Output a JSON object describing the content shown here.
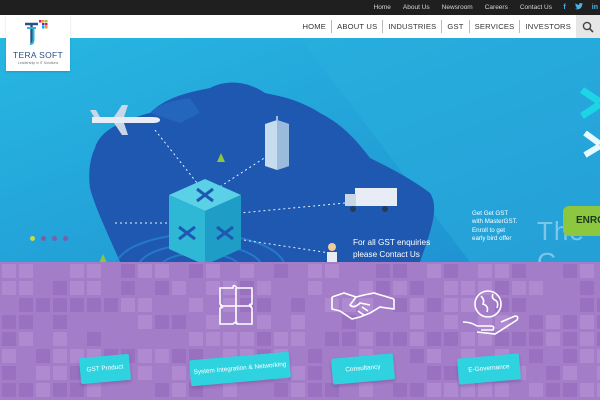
{
  "top_links": [
    "Home",
    "About Us",
    "Newsroom",
    "Careers",
    "Contact Us"
  ],
  "social": [
    {
      "icon": "facebook-icon",
      "glyph": "f"
    },
    {
      "icon": "twitter-icon",
      "glyph": "t"
    },
    {
      "icon": "linkedin-icon",
      "glyph": "in"
    }
  ],
  "menu": [
    "HOME",
    "ABOUT US",
    "INDUSTRIES",
    "GST",
    "SERVICES",
    "INVESTORS"
  ],
  "logo": {
    "name": "TERA SOFT",
    "tagline": "Leadership in IT Solutions"
  },
  "hero": {
    "enquiry_line1": "For all GST enquiries",
    "enquiry_line2": "please Contact Us",
    "promo": "Get Get GST with MasterGST. Enroll to get early bird offer",
    "enroll_button": "ENRO",
    "overlay_text": "The G"
  },
  "slider": {
    "total": 4,
    "active": 1
  },
  "services": [
    {
      "label": "GST Product",
      "icon": "puzzle-icon"
    },
    {
      "label": "System Integration & Networking",
      "icon": "puzzle-icon"
    },
    {
      "label": "Consultancy",
      "icon": "handshake-icon"
    },
    {
      "label": "E-Governance",
      "icon": "globe-hand-icon"
    }
  ],
  "colors": {
    "topbar": "#1f1f1f",
    "hero_sea": "#29b9e2",
    "hero_land": "#1f58b0",
    "services_bg": "#a47dc8",
    "label_cyan": "#2fd3e0",
    "enroll_green": "#8dc63f"
  }
}
